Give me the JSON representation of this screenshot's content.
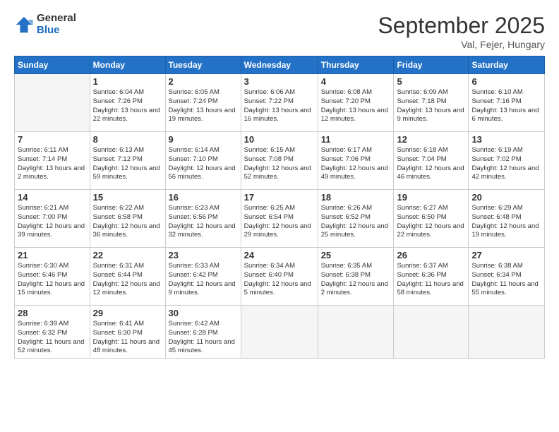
{
  "logo": {
    "general": "General",
    "blue": "Blue"
  },
  "title": "September 2025",
  "location": "Val, Fejer, Hungary",
  "days_of_week": [
    "Sunday",
    "Monday",
    "Tuesday",
    "Wednesday",
    "Thursday",
    "Friday",
    "Saturday"
  ],
  "weeks": [
    [
      {
        "day": "",
        "info": ""
      },
      {
        "day": "1",
        "info": "Sunrise: 6:04 AM\nSunset: 7:26 PM\nDaylight: 13 hours\nand 22 minutes."
      },
      {
        "day": "2",
        "info": "Sunrise: 6:05 AM\nSunset: 7:24 PM\nDaylight: 13 hours\nand 19 minutes."
      },
      {
        "day": "3",
        "info": "Sunrise: 6:06 AM\nSunset: 7:22 PM\nDaylight: 13 hours\nand 16 minutes."
      },
      {
        "day": "4",
        "info": "Sunrise: 6:08 AM\nSunset: 7:20 PM\nDaylight: 13 hours\nand 12 minutes."
      },
      {
        "day": "5",
        "info": "Sunrise: 6:09 AM\nSunset: 7:18 PM\nDaylight: 13 hours\nand 9 minutes."
      },
      {
        "day": "6",
        "info": "Sunrise: 6:10 AM\nSunset: 7:16 PM\nDaylight: 13 hours\nand 6 minutes."
      }
    ],
    [
      {
        "day": "7",
        "info": "Sunrise: 6:11 AM\nSunset: 7:14 PM\nDaylight: 13 hours\nand 2 minutes."
      },
      {
        "day": "8",
        "info": "Sunrise: 6:13 AM\nSunset: 7:12 PM\nDaylight: 12 hours\nand 59 minutes."
      },
      {
        "day": "9",
        "info": "Sunrise: 6:14 AM\nSunset: 7:10 PM\nDaylight: 12 hours\nand 56 minutes."
      },
      {
        "day": "10",
        "info": "Sunrise: 6:15 AM\nSunset: 7:08 PM\nDaylight: 12 hours\nand 52 minutes."
      },
      {
        "day": "11",
        "info": "Sunrise: 6:17 AM\nSunset: 7:06 PM\nDaylight: 12 hours\nand 49 minutes."
      },
      {
        "day": "12",
        "info": "Sunrise: 6:18 AM\nSunset: 7:04 PM\nDaylight: 12 hours\nand 46 minutes."
      },
      {
        "day": "13",
        "info": "Sunrise: 6:19 AM\nSunset: 7:02 PM\nDaylight: 12 hours\nand 42 minutes."
      }
    ],
    [
      {
        "day": "14",
        "info": "Sunrise: 6:21 AM\nSunset: 7:00 PM\nDaylight: 12 hours\nand 39 minutes."
      },
      {
        "day": "15",
        "info": "Sunrise: 6:22 AM\nSunset: 6:58 PM\nDaylight: 12 hours\nand 36 minutes."
      },
      {
        "day": "16",
        "info": "Sunrise: 6:23 AM\nSunset: 6:56 PM\nDaylight: 12 hours\nand 32 minutes."
      },
      {
        "day": "17",
        "info": "Sunrise: 6:25 AM\nSunset: 6:54 PM\nDaylight: 12 hours\nand 29 minutes."
      },
      {
        "day": "18",
        "info": "Sunrise: 6:26 AM\nSunset: 6:52 PM\nDaylight: 12 hours\nand 25 minutes."
      },
      {
        "day": "19",
        "info": "Sunrise: 6:27 AM\nSunset: 6:50 PM\nDaylight: 12 hours\nand 22 minutes."
      },
      {
        "day": "20",
        "info": "Sunrise: 6:29 AM\nSunset: 6:48 PM\nDaylight: 12 hours\nand 19 minutes."
      }
    ],
    [
      {
        "day": "21",
        "info": "Sunrise: 6:30 AM\nSunset: 6:46 PM\nDaylight: 12 hours\nand 15 minutes."
      },
      {
        "day": "22",
        "info": "Sunrise: 6:31 AM\nSunset: 6:44 PM\nDaylight: 12 hours\nand 12 minutes."
      },
      {
        "day": "23",
        "info": "Sunrise: 6:33 AM\nSunset: 6:42 PM\nDaylight: 12 hours\nand 9 minutes."
      },
      {
        "day": "24",
        "info": "Sunrise: 6:34 AM\nSunset: 6:40 PM\nDaylight: 12 hours\nand 5 minutes."
      },
      {
        "day": "25",
        "info": "Sunrise: 6:35 AM\nSunset: 6:38 PM\nDaylight: 12 hours\nand 2 minutes."
      },
      {
        "day": "26",
        "info": "Sunrise: 6:37 AM\nSunset: 6:36 PM\nDaylight: 11 hours\nand 58 minutes."
      },
      {
        "day": "27",
        "info": "Sunrise: 6:38 AM\nSunset: 6:34 PM\nDaylight: 11 hours\nand 55 minutes."
      }
    ],
    [
      {
        "day": "28",
        "info": "Sunrise: 6:39 AM\nSunset: 6:32 PM\nDaylight: 11 hours\nand 52 minutes."
      },
      {
        "day": "29",
        "info": "Sunrise: 6:41 AM\nSunset: 6:30 PM\nDaylight: 11 hours\nand 48 minutes."
      },
      {
        "day": "30",
        "info": "Sunrise: 6:42 AM\nSunset: 6:28 PM\nDaylight: 11 hours\nand 45 minutes."
      },
      {
        "day": "",
        "info": ""
      },
      {
        "day": "",
        "info": ""
      },
      {
        "day": "",
        "info": ""
      },
      {
        "day": "",
        "info": ""
      }
    ]
  ]
}
